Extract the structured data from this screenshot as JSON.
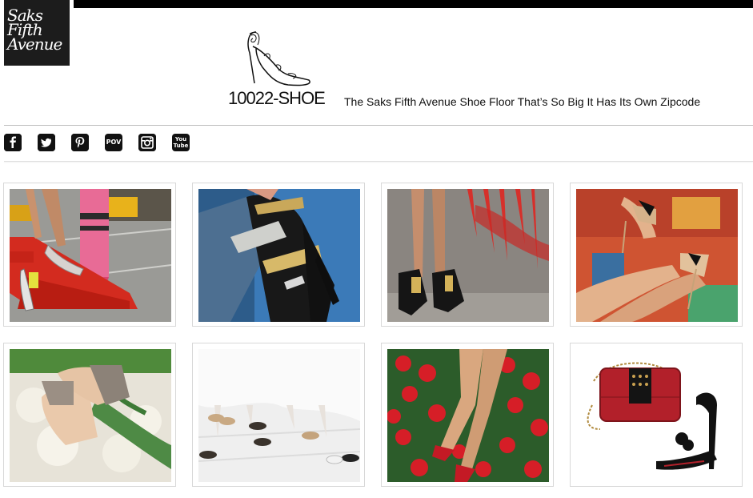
{
  "header": {
    "store_logo_text": "Saks\nFifth\nAvenue",
    "brand_name": "10022-SHOE",
    "tagline": "The Saks Fifth Avenue Shoe Floor That’s So Big It Has Its Own Zipcode"
  },
  "social": [
    {
      "icon": "facebook-icon"
    },
    {
      "icon": "twitter-icon"
    },
    {
      "icon": "pinterest-icon"
    },
    {
      "icon": "pov-icon",
      "label": "POV"
    },
    {
      "icon": "instagram-icon"
    },
    {
      "icon": "youtube-icon",
      "label": "You\nTube"
    }
  ],
  "gallery": [
    {
      "subject": "red-crayon-heels-photo"
    },
    {
      "subject": "metallic-strappy-sandal-photo"
    },
    {
      "subject": "black-gold-sandals-graffiti-photo"
    },
    {
      "subject": "nude-pumps-graffiti-photo"
    },
    {
      "subject": "floral-boat-sandals-photo"
    },
    {
      "subject": "ballet-flats-tulle-photo"
    },
    {
      "subject": "red-lace-flats-roses-photo"
    },
    {
      "subject": "red-clutch-and-sandal-photo"
    }
  ],
  "colors": {
    "accent": "#e31b23",
    "dark": "#111111"
  }
}
